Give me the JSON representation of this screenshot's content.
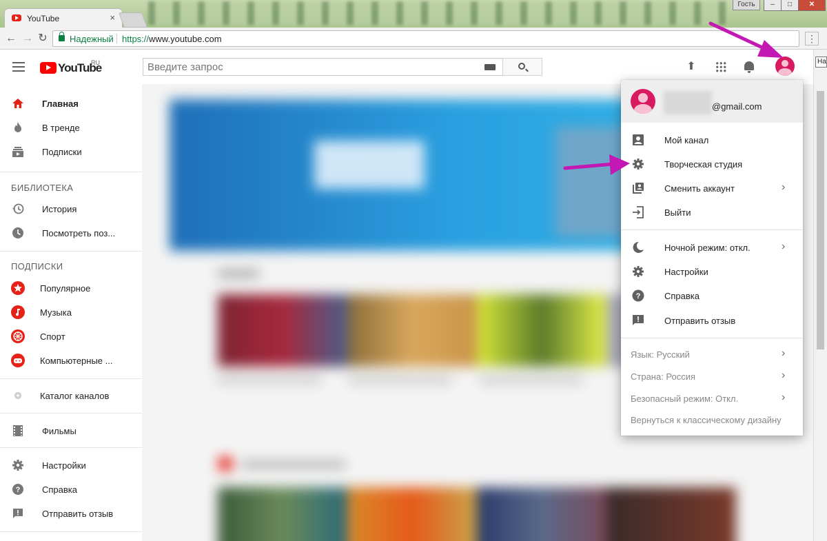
{
  "browser": {
    "tab_title": "YouTube",
    "tab_close": "×",
    "guest_label": "Гость",
    "secure_label": "Надежный",
    "url_proto": "https://",
    "url_host": "www.youtube.com",
    "tooltip": "На"
  },
  "header": {
    "logo_text": "YouTube",
    "country": "RU",
    "search_placeholder": "Введите запрос"
  },
  "sidebar": {
    "main": [
      {
        "label": "Главная",
        "icon": "home-icon"
      },
      {
        "label": "В тренде",
        "icon": "fire-icon"
      },
      {
        "label": "Подписки",
        "icon": "subscriptions-icon"
      }
    ],
    "library_title": "БИБЛИОТЕКА",
    "library": [
      {
        "label": "История",
        "icon": "history-icon"
      },
      {
        "label": "Посмотреть поз...",
        "icon": "clock-icon"
      }
    ],
    "subs_title": "ПОДПИСКИ",
    "subs": [
      {
        "label": "Популярное",
        "icon": "star-icon"
      },
      {
        "label": "Музыка",
        "icon": "music-icon"
      },
      {
        "label": "Спорт",
        "icon": "sport-icon"
      },
      {
        "label": "Компьютерные ...",
        "icon": "gamepad-icon"
      }
    ],
    "catalog": "Каталог каналов",
    "movies": "Фильмы",
    "footer": [
      {
        "label": "Настройки",
        "icon": "gear-icon"
      },
      {
        "label": "Справка",
        "icon": "help-icon"
      },
      {
        "label": "Отправить отзыв",
        "icon": "feedback-icon"
      }
    ]
  },
  "menu": {
    "email": "@gmail.com",
    "account": [
      {
        "label": "Мой канал",
        "icon": "account-box-icon"
      },
      {
        "label": "Творческая студия",
        "icon": "gear-icon"
      },
      {
        "label": "Сменить аккаунт",
        "icon": "switch-account-icon"
      },
      {
        "label": "Выйти",
        "icon": "sign-out-icon"
      }
    ],
    "settings": [
      {
        "label": "Ночной режим: откл.",
        "icon": "moon-icon"
      },
      {
        "label": "Настройки",
        "icon": "gear-icon"
      },
      {
        "label": "Справка",
        "icon": "help-icon"
      },
      {
        "label": "Отправить отзыв",
        "icon": "feedback-icon"
      }
    ],
    "prefs": [
      {
        "label": "Язык: Русский"
      },
      {
        "label": "Страна: Россия"
      },
      {
        "label": "Безопасный режим: Откл."
      },
      {
        "label": "Вернуться к классическому дизайну"
      }
    ]
  },
  "colors": {
    "accent": "#e62117",
    "avatar": "#d81b60",
    "annotation_arrow": "#c418b4"
  }
}
